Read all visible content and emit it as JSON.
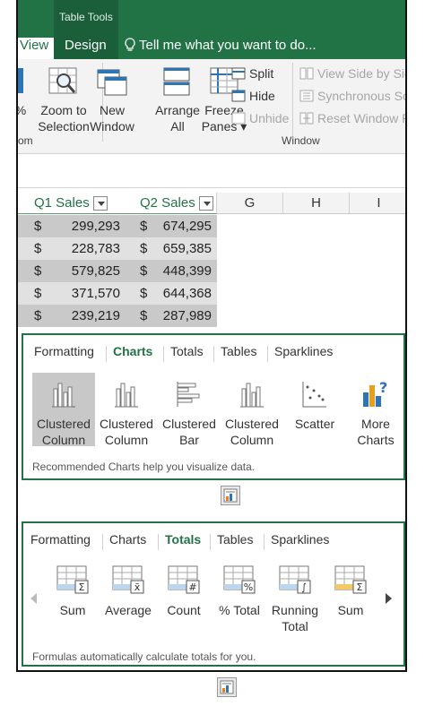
{
  "tabbar": {
    "table_tools": "Table Tools",
    "tab_view": "View",
    "tab_design": "Design",
    "tell_me": "Tell me what you want to do..."
  },
  "ribbon": {
    "pct_fragment": "%",
    "zoom_to_selection": [
      "Zoom to",
      "Selection"
    ],
    "zoom_group": "om",
    "new_window": [
      "New",
      "Window"
    ],
    "arrange_all": [
      "Arrange",
      "All"
    ],
    "freeze_panes": [
      "Freeze",
      "Panes ▾"
    ],
    "split": "Split",
    "hide": "Hide",
    "unhide": "Unhide",
    "view_side_by_side": "View Side by Side",
    "synchronous_scrolling": "Synchronous Scrolling",
    "reset_window_position": "Reset Window Position",
    "window_group": "Window"
  },
  "grid": {
    "columns": {
      "q1": "Q1 Sales",
      "q2": "Q2 Sales",
      "g": "G",
      "h": "H",
      "i": "I"
    },
    "currency": "$",
    "rows": [
      {
        "q1": "299,293",
        "q2": "674,295"
      },
      {
        "q1": "228,783",
        "q2": "659,385"
      },
      {
        "q1": "579,825",
        "q2": "448,399"
      },
      {
        "q1": "371,570",
        "q2": "644,368"
      },
      {
        "q1": "239,219",
        "q2": "287,989"
      }
    ]
  },
  "charts_popup": {
    "tabs": [
      "Formatting",
      "Charts",
      "Totals",
      "Tables",
      "Sparklines"
    ],
    "selected_tab": "Charts",
    "items": [
      {
        "label": [
          "Clustered",
          "Column"
        ],
        "icon": "clustered-column-icon",
        "selected": true
      },
      {
        "label": [
          "Clustered",
          "Column"
        ],
        "icon": "clustered-column-icon"
      },
      {
        "label": [
          "Clustered",
          "Bar"
        ],
        "icon": "clustered-bar-icon"
      },
      {
        "label": [
          "Clustered",
          "Column"
        ],
        "icon": "clustered-column-icon"
      },
      {
        "label": [
          "Scatter",
          ""
        ],
        "icon": "scatter-icon"
      },
      {
        "label": [
          "More",
          "Charts"
        ],
        "icon": "more-charts-icon"
      }
    ],
    "footer": "Recommended Charts help you visualize data."
  },
  "totals_popup": {
    "tabs": [
      "Formatting",
      "Charts",
      "Totals",
      "Tables",
      "Sparklines"
    ],
    "selected_tab": "Totals",
    "items": [
      {
        "label": [
          "Sum",
          ""
        ],
        "icon": "sum-icon"
      },
      {
        "label": [
          "Average",
          ""
        ],
        "icon": "average-icon"
      },
      {
        "label": [
          "Count",
          ""
        ],
        "icon": "count-icon"
      },
      {
        "label": [
          "% Total",
          ""
        ],
        "icon": "percent-total-icon"
      },
      {
        "label": [
          "Running",
          "Total"
        ],
        "icon": "running-total-icon"
      },
      {
        "label": [
          "Sum",
          ""
        ],
        "icon": "sum-icon"
      }
    ],
    "footer": "Formulas automatically calculate totals for you."
  },
  "colors": {
    "accent": "#217346",
    "selected_bg": "#c8c8c8"
  }
}
